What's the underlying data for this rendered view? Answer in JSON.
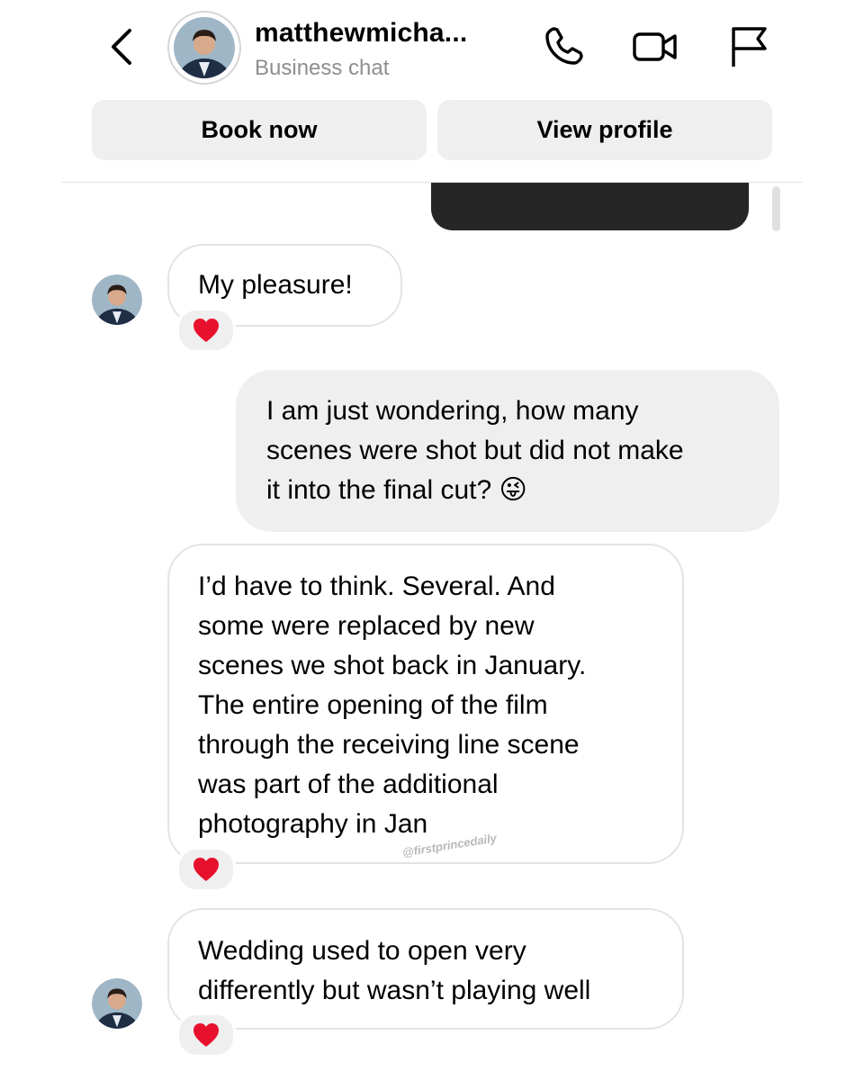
{
  "header": {
    "username": "matthewmicha...",
    "subtitle": "Business chat",
    "icons": [
      "chevron-left-icon",
      "avatar",
      "phone-icon",
      "video-camera-icon",
      "flag-icon"
    ]
  },
  "actions": {
    "book_label": "Book now",
    "profile_label": "View profile"
  },
  "messages": [
    {
      "sender": "them",
      "text": "My pleasure!",
      "reaction": "❤️"
    },
    {
      "sender": "me",
      "lines": [
        "I am just wondering, how many",
        "scenes were shot but did not make",
        "it into the final cut? 😜"
      ]
    },
    {
      "sender": "them",
      "lines": [
        "I’d have to think. Several. And",
        "some were replaced by new",
        "scenes we  shot back in January.",
        "The entire opening of the film",
        "through the receiving line scene",
        "was part of the additional",
        "photography in Jan"
      ],
      "reaction": "❤️"
    },
    {
      "sender": "them",
      "lines": [
        "Wedding used to open very",
        "differently but wasn’t playing well"
      ],
      "reaction": "❤️"
    }
  ],
  "watermark": "@firstprincedaily",
  "colors": {
    "incoming_border": "#e3e3e3",
    "outgoing_bubble": "#efefef",
    "secondary_text": "#8e8e8e",
    "heart": "#e8112d"
  }
}
